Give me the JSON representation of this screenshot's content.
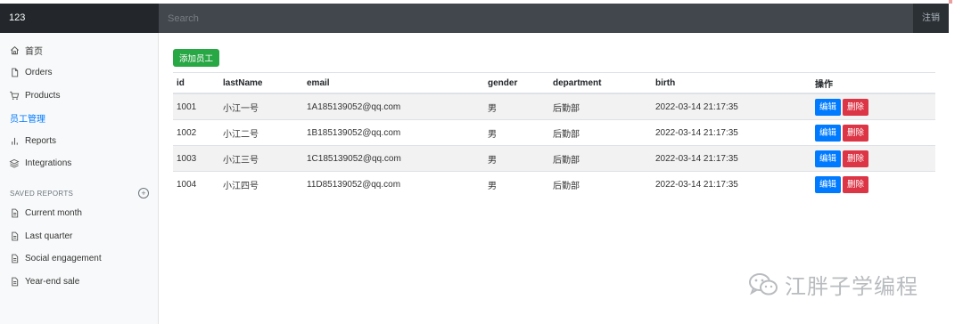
{
  "navbar": {
    "brand": "123",
    "search_placeholder": "Search",
    "signout": "注销"
  },
  "sidebar": {
    "items": [
      {
        "label": "首页",
        "icon": "home-icon",
        "active": false
      },
      {
        "label": "Orders",
        "icon": "file-icon",
        "active": false
      },
      {
        "label": "Products",
        "icon": "cart-icon",
        "active": false
      },
      {
        "label": "员工管理",
        "icon": "",
        "active": true
      },
      {
        "label": "Reports",
        "icon": "bar-chart-icon",
        "active": false
      },
      {
        "label": "Integrations",
        "icon": "layers-icon",
        "active": false
      }
    ],
    "saved_heading": "SAVED REPORTS",
    "saved": [
      {
        "label": "Current month",
        "icon": "file-text-icon"
      },
      {
        "label": "Last quarter",
        "icon": "file-text-icon"
      },
      {
        "label": "Social engagement",
        "icon": "file-text-icon"
      },
      {
        "label": "Year-end sale",
        "icon": "file-text-icon"
      }
    ]
  },
  "main": {
    "add_button": "添加员工",
    "columns": [
      "id",
      "lastName",
      "email",
      "gender",
      "department",
      "birth",
      "操作"
    ],
    "rows": [
      [
        "1001",
        "小江一号",
        "1A185139052@qq.com",
        "男",
        "后勤部",
        "2022-03-14 21:17:35"
      ],
      [
        "1002",
        "小江二号",
        "1B185139052@qq.com",
        "男",
        "后勤部",
        "2022-03-14 21:17:35"
      ],
      [
        "1003",
        "小江三号",
        "1C185139052@qq.com",
        "男",
        "后勤部",
        "2022-03-14 21:17:35"
      ],
      [
        "1004",
        "小江四号",
        "11D85139052@qq.com",
        "男",
        "后勤部",
        "2022-03-14 21:17:35"
      ]
    ],
    "edit_label": "编辑",
    "delete_label": "删除"
  },
  "watermark": {
    "text": "江胖子学编程"
  },
  "colors": {
    "navbar": "#343a40",
    "active_link": "#007bff",
    "add": "#28a745",
    "edit": "#007bff",
    "delete": "#dc3545"
  }
}
